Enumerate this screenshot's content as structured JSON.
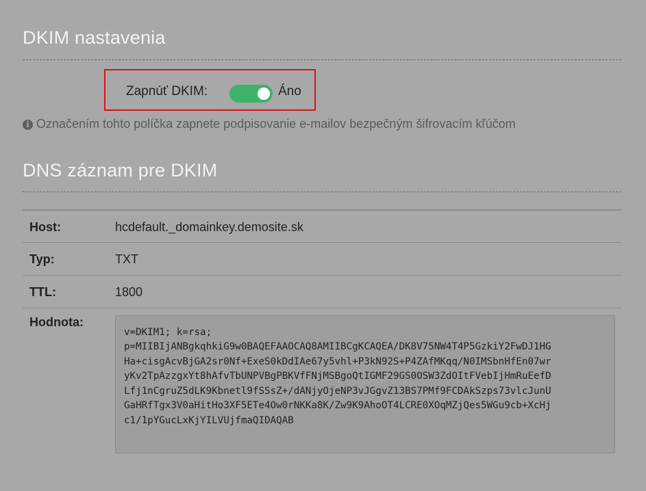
{
  "dkim_settings": {
    "title": "DKIM nastavenia",
    "toggle_label": "Zapnúť DKIM:",
    "toggle_state": "Áno",
    "toggle_on": true,
    "hint": "Označením tohto políčka zapnete podpisovanie e-mailov bezpečným šifrovacím kľúčom",
    "hint_icon": "info-icon"
  },
  "dns_record": {
    "title": "DNS záznam pre DKIM",
    "host_label": "Host:",
    "host_value": "hcdefault._domainkey.demosite.sk",
    "type_label": "Typ:",
    "type_value": "TXT",
    "ttl_label": "TTL:",
    "ttl_value": "1800",
    "value_label": "Hodnota:",
    "value_lines": [
      "v=DKIM1; k=rsa;",
      "p=MIIBIjANBgkqhkiG9w0BAQEFAAOCAQ8AMIIBCgKCAQEA/DK8V75NW4T4P5GzkiY2FwDJ1HG",
      "Ha+cisgAcvBjGA2sr0Nf+ExeS0kDdIAe67y5vhl+P3kN92S+P4ZAfMKqq/N0IMSbnHfEn07wr",
      "yKv2TpAzzgxYt8hAfvTbUNPVBgPBKVfFNjMSBgoQtIGMF29GS0OSW3ZdOItFVebIjHmRuEefD",
      "Lfj1nCgruZ5dLK9Kbnetl9fSSsZ+/dANjyOjeNP3vJGgvZ13BS7PMf9FCDAkSzps73vlcJunU",
      "GaHRfTgx3V0aHitHo3XF5ETe4Ow0rNKKa8K/Zw9K9AhoOT4LCRE0XOqMZjQes5WGu9cb+XcHj",
      "c1/1pYGucLxKjYILVUjfmaQIDAQAB"
    ]
  },
  "colors": {
    "background": "#a8a8a8",
    "toggle_on": "#3fb26a",
    "highlight_border": "#e0101a",
    "title": "#f2f2f2"
  }
}
